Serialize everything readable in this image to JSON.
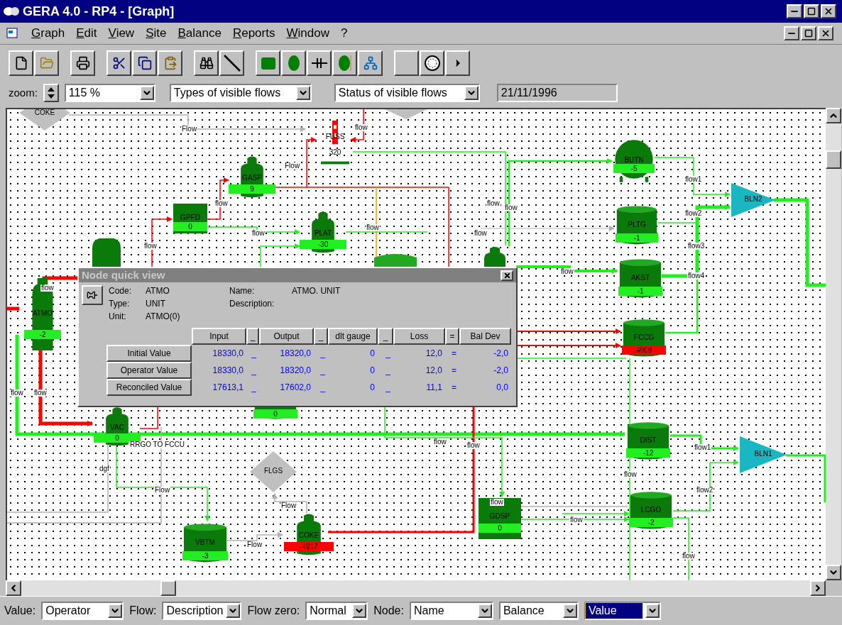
{
  "window": {
    "title": "GERA 4.0 - RP4 - [Graph]"
  },
  "menu": [
    "Graph",
    "Edit",
    "View",
    "Site",
    "Balance",
    "Reports",
    "Window",
    "?"
  ],
  "zoom_bar": {
    "label": "zoom:",
    "zoom": "115 %",
    "flow_types": "Types of visible flows",
    "flow_status": "Status of visible flows",
    "date": "21/11/1996"
  },
  "graph": {
    "nodes": [
      {
        "kind": "diamond",
        "label": "COKE"
      },
      {
        "kind": "meter",
        "label": "FUSS",
        "value": "320",
        "alarm": false
      },
      {
        "kind": "drum",
        "label": "GASP",
        "value": "9",
        "alarm": false
      },
      {
        "kind": "box",
        "label": "GPFD",
        "value": "0",
        "alarm": false
      },
      {
        "kind": "drum",
        "label": "PLAT",
        "value": "-30",
        "alarm": false
      },
      {
        "kind": "sphere",
        "label": "BUTN",
        "value": "-5",
        "alarm": false
      },
      {
        "kind": "tank",
        "label": "PLTG",
        "value": "-1",
        "alarm": false
      },
      {
        "kind": "tank",
        "label": "AKST",
        "value": "-1",
        "alarm": false
      },
      {
        "kind": "tank",
        "label": "FCCG",
        "value": "4908",
        "alarm": true
      },
      {
        "kind": "blender",
        "label": "BLN2"
      },
      {
        "kind": "column",
        "label": "ATMO",
        "value": "-2",
        "alarm": false
      },
      {
        "kind": "drum",
        "label": "VAC",
        "value": "0",
        "alarm": false
      },
      {
        "kind": "tank",
        "value": "0",
        "alarm": false
      },
      {
        "kind": "tank",
        "label": "DIST",
        "value": "-12",
        "alarm": false
      },
      {
        "kind": "blender",
        "label": "BLN1"
      },
      {
        "kind": "diamond",
        "label": "FLGS"
      },
      {
        "kind": "box",
        "label": "GDSP",
        "value": "0",
        "alarm": false
      },
      {
        "kind": "tank",
        "label": "LCGO",
        "value": "-2",
        "alarm": false
      },
      {
        "kind": "tank",
        "label": "VBTM",
        "value": "-3",
        "alarm": false
      },
      {
        "kind": "drum",
        "label": "COKE",
        "value": "-4917",
        "alarm": true
      }
    ],
    "flow_labels": [
      "Flow",
      "flow",
      "Flow",
      "flow",
      "flow",
      "flow",
      "flow",
      "flow",
      "flow",
      "flow",
      "flow1",
      "flow2",
      "flow3",
      "flow4",
      "flow",
      "flow",
      "flow",
      "flow",
      "flow",
      "flow",
      "dgf",
      "Flow",
      "flow",
      "flow1",
      "flow2",
      "Flow",
      "flow",
      "Flow",
      "flow",
      "flow",
      "RRGO TO FCCU"
    ]
  },
  "quick_view": {
    "title": "Node quick view",
    "fields": [
      {
        "label": "Code:",
        "value": "ATMO"
      },
      {
        "label": "Name:",
        "value": "ATMO. UNIT"
      },
      {
        "label": "Type:",
        "value": "UNIT"
      },
      {
        "label": "Description:"
      },
      {
        "label": "Unit:",
        "value": "ATMO(0)"
      }
    ],
    "columns": [
      "Input",
      "_",
      "Output",
      "_",
      "dlt gauge",
      "_",
      "Loss",
      "=",
      "Bal Dev"
    ],
    "rows": [
      {
        "label": "Initial Value",
        "cells": [
          "18330,0",
          "_",
          "18320,0",
          "_",
          "0",
          "_",
          "12,0",
          "=",
          "-2,0"
        ]
      },
      {
        "label": "Operator Value",
        "cells": [
          "18330,0",
          "_",
          "18320,0",
          "_",
          "0",
          "_",
          "12,0",
          "=",
          "-2,0"
        ]
      },
      {
        "label": "Reconciled Value",
        "cells": [
          "17613,1",
          "_",
          "17602,0",
          "_",
          "0",
          "_",
          "11,1",
          "=",
          "0,0"
        ]
      }
    ]
  },
  "status_bar": [
    {
      "label": "Value:",
      "value": "Operator",
      "focused": false
    },
    {
      "label": "Flow:",
      "value": "Description",
      "focused": false
    },
    {
      "label": "Flow zero:",
      "value": "Normal",
      "focused": false
    },
    {
      "label": "Node:",
      "value": "Name",
      "focused": false
    },
    {
      "value": "Balance",
      "focused": false
    },
    {
      "value": "Value",
      "focused": true
    }
  ]
}
